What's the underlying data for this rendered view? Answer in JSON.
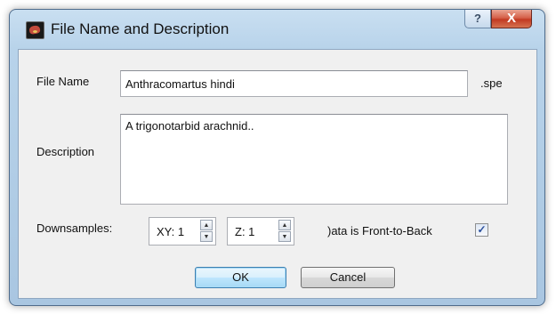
{
  "dialog": {
    "title": "File Name and Description",
    "help_glyph": "?",
    "close_glyph": "X"
  },
  "file_name": {
    "label": "File Name",
    "value": "Anthracomartus hindi",
    "extension": ".spe"
  },
  "description": {
    "label": "Description",
    "value": "A trigonotarbid arachnid.."
  },
  "downsamples": {
    "label": "Downsamples:",
    "xy_value": "XY: 1",
    "z_value": "Z: 1"
  },
  "front_to_back": {
    "label": ")ata is Front-to-Back",
    "checked": true,
    "check_glyph": "✓"
  },
  "buttons": {
    "ok": "OK",
    "cancel": "Cancel"
  },
  "icons": {
    "app": "spiders-app-icon",
    "help": "help-icon",
    "close": "close-icon",
    "spin_up": "spin-up-icon",
    "spin_down": "spin-down-icon"
  }
}
